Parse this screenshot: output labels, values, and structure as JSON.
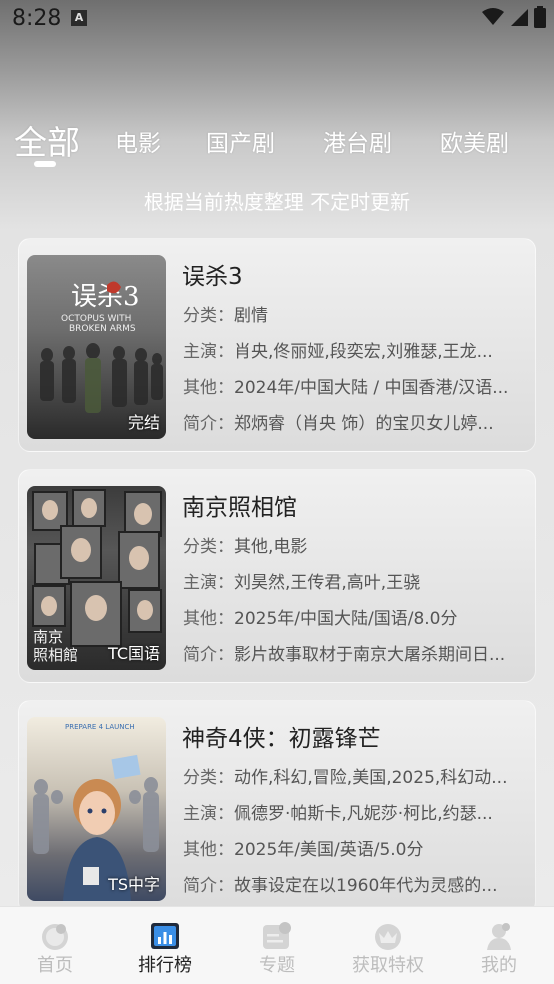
{
  "status": {
    "time": "8:28",
    "notification": "A"
  },
  "tabs": [
    {
      "label": "全部",
      "active": true
    },
    {
      "label": "电影",
      "active": false
    },
    {
      "label": "国产剧",
      "active": false
    },
    {
      "label": "港台剧",
      "active": false
    },
    {
      "label": "欧美剧",
      "active": false
    }
  ],
  "subtitle": "根据当前热度整理 不定时更新",
  "labels": {
    "category": "分类：",
    "cast": "主演：",
    "other": "其他：",
    "intro": "简介："
  },
  "items": [
    {
      "title": "误杀3",
      "badge": "完结",
      "poster_text": "误杀3",
      "poster_subtext": "OCTOPUS WITH BROKEN ARMS",
      "category": "剧情",
      "cast": "肖央,佟丽娅,段奕宏,刘雅瑟,王龙...",
      "other": "2024年/中国大陆 / 中国香港/汉语...",
      "intro": "郑炳睿（肖央 饰）的宝贝女儿婷..."
    },
    {
      "title": "南京照相馆",
      "badge": "TC国语",
      "poster_text": "南京照相馆",
      "poster_subtext": "",
      "category": "其他,电影",
      "cast": "刘昊然,王传君,高叶,王骁",
      "other": "2025年/中国大陆/国语/8.0分",
      "intro": "影片故事取材于南京大屠杀期间日..."
    },
    {
      "title": "神奇4侠：初露锋芒",
      "badge": "TS中字",
      "poster_text": "PREPARE 4 LAUNCH",
      "poster_subtext": "",
      "category": "动作,科幻,冒险,美国,2025,科幻动...",
      "cast": "佩德罗·帕斯卡,凡妮莎·柯比,约瑟...",
      "other": "2025年/美国/英语/5.0分",
      "intro": "故事设定在以1960年代为灵感的..."
    }
  ],
  "nav": [
    {
      "label": "首页",
      "icon": "home-icon",
      "active": false
    },
    {
      "label": "排行榜",
      "icon": "ranking-icon",
      "active": true
    },
    {
      "label": "专题",
      "icon": "topic-icon",
      "active": false
    },
    {
      "label": "获取特权",
      "icon": "privilege-icon",
      "active": false
    },
    {
      "label": "我的",
      "icon": "profile-icon",
      "active": false
    }
  ],
  "colors": {
    "accent": "#3a7bd5",
    "text": "#222222",
    "muted": "#bdbdbd"
  }
}
